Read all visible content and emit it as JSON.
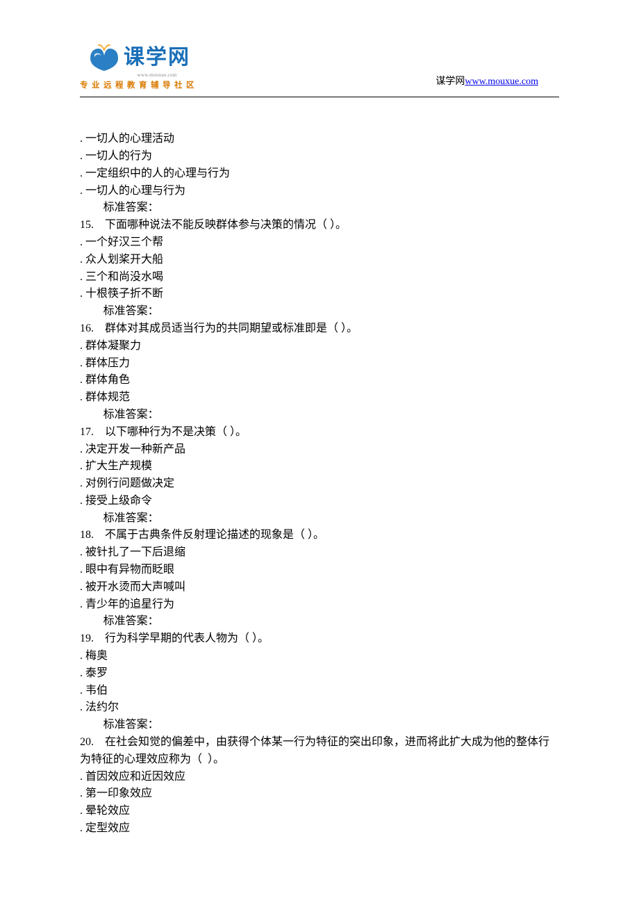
{
  "header": {
    "logo_main": "课学网",
    "logo_url_small": "www.mouxue.com",
    "logo_tagline": "专业远程教育辅导社区",
    "site_label": "谋学网",
    "site_url": "www.mouxue.com"
  },
  "q14": {
    "options": [
      "一切人的心理活动",
      "一切人的行为",
      "一定组织中的人的心理与行为",
      "一切人的心理与行为"
    ],
    "answer_label": "标准答案："
  },
  "q15": {
    "stem": "15.    下面哪种说法不能反映群体参与决策的情况（ ）。",
    "options": [
      "一个好汉三个帮",
      "众人划桨开大船",
      "三个和尚没水喝",
      "十根筷子折不断"
    ],
    "answer_label": "标准答案："
  },
  "q16": {
    "stem": "16.    群体对其成员适当行为的共同期望或标准即是（ ）。",
    "options": [
      "群体凝聚力",
      "群体压力",
      "群体角色",
      "群体规范"
    ],
    "answer_label": "标准答案："
  },
  "q17": {
    "stem": "17.    以下哪种行为不是决策（ ）。",
    "options": [
      "决定开发一种新产品",
      "扩大生产规模",
      "对例行问题做决定",
      "接受上级命令"
    ],
    "answer_label": "标准答案："
  },
  "q18": {
    "stem": "18.    不属于古典条件反射理论描述的现象是（ ）。",
    "options": [
      "被针扎了一下后退缩",
      "眼中有异物而眨眼",
      "被开水烫而大声喊叫",
      "青少年的追星行为"
    ],
    "answer_label": "标准答案："
  },
  "q19": {
    "stem": "19.    行为科学早期的代表人物为（ ）。",
    "options": [
      "梅奥",
      "泰罗",
      "韦伯",
      "法约尔"
    ],
    "answer_label": "标准答案："
  },
  "q20": {
    "stem": "20.    在社会知觉的偏差中，由获得个体某一行为特征的突出印象，进而将此扩大成为他的整体行为特征的心理效应称为（  ）。",
    "options": [
      "首因效应和近因效应",
      "第一印象效应",
      "晕轮效应",
      "定型效应"
    ]
  }
}
